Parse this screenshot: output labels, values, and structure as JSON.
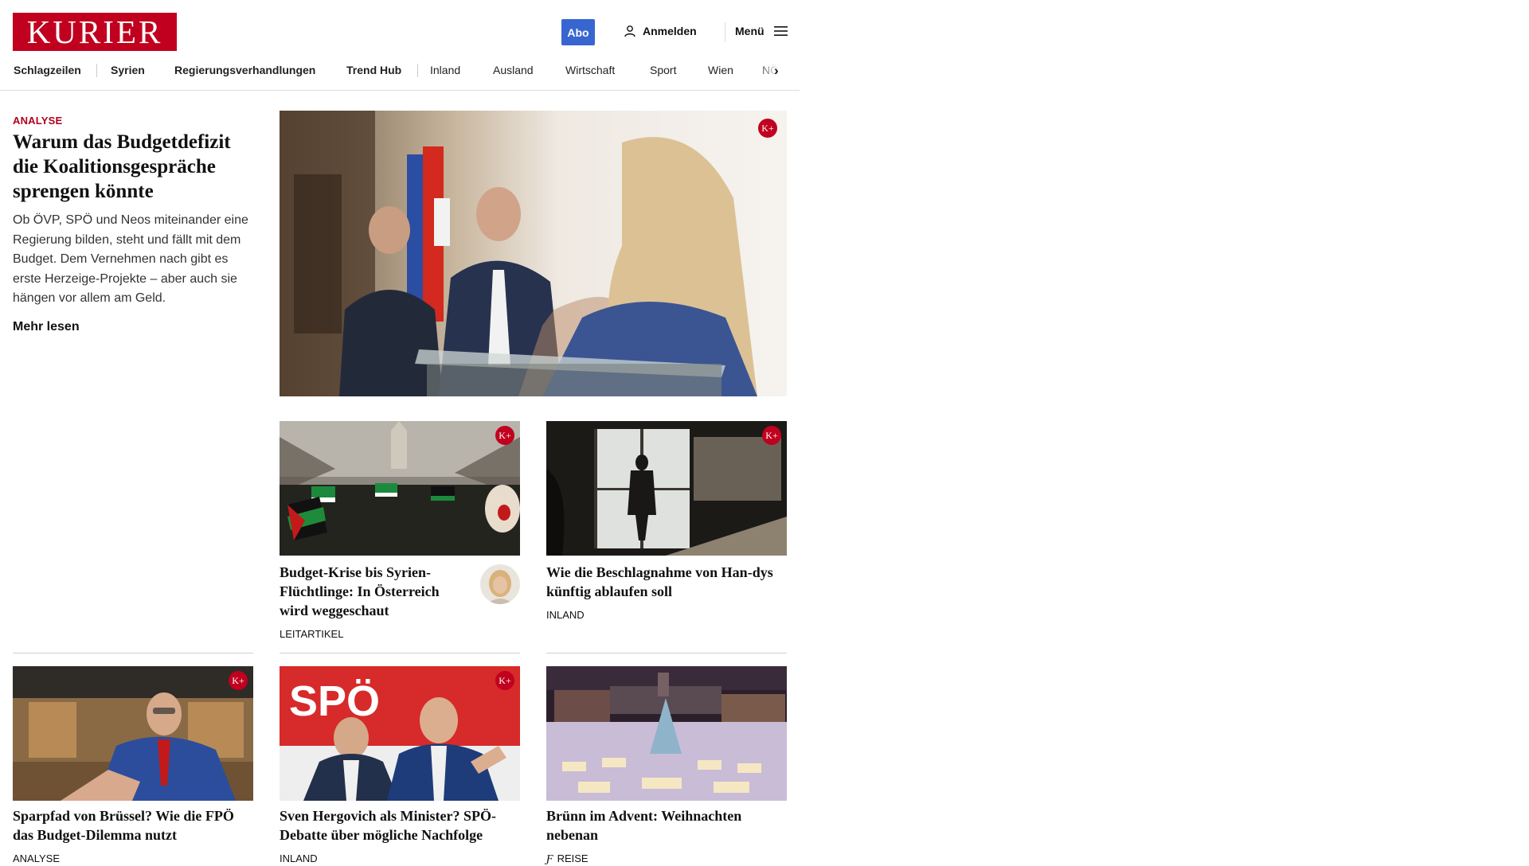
{
  "header": {
    "logo": "KURIER",
    "abo_label": "Abo",
    "login_label": "Anmelden",
    "menu_label": "Menü",
    "brand_color": "#c0001e",
    "abo_color": "#3866d0"
  },
  "nav": {
    "items": [
      "Schlagzeilen",
      "Syrien",
      "Regierungsverhandlungen",
      "Trend Hub",
      "Inland",
      "Ausland",
      "Wirtschaft",
      "Sport",
      "Wien",
      "NÖ"
    ]
  },
  "lead": {
    "kicker": "ANALYSE",
    "title": "Warum das Budgetdefizit die Koalitionsgespräche sprengen könnte",
    "teaser": "Ob ÖVP, SPÖ und Neos miteinander eine Regierung bilden, steht und fällt mit dem Budget. Dem Vernehmen nach gibt es erste Herzeige-Projekte – aber auch sie hängen vor allem am Geld.",
    "more_label": "Mehr lesen",
    "badge": "K+"
  },
  "cards": [
    {
      "title": "Budget-Krise bis Syrien-Flüchtlinge: In Österreich wird weggeschaut",
      "category": "LEITARTIKEL",
      "badge": "K+"
    },
    {
      "title": "Wie die Beschlagnahme von Han-dys künftig ablaufen soll",
      "category": "INLAND",
      "badge": "K+"
    },
    {
      "title": "Sparpfad von Brüssel? Wie die FPÖ das Budget-Dilemma nutzt",
      "category": "ANALYSE",
      "badge": "K+"
    },
    {
      "title": "Sven Hergovich als Minister? SPÖ-Debatte über mögliche Nachfolge",
      "category": "INLAND",
      "badge": "K+"
    },
    {
      "title": "Brünn im Advent: Weihnachten nebenan",
      "category": "REISE"
    }
  ]
}
